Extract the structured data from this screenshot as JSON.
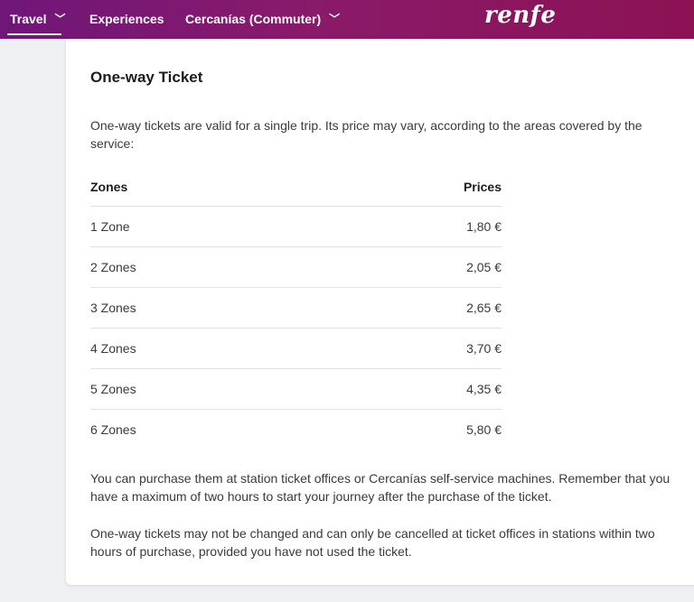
{
  "nav": {
    "travel": "Travel",
    "experiences": "Experiences",
    "cercanias": "Cercanías (Commuter)",
    "logo": "renfe"
  },
  "colors": {
    "brand_gradient_start": "#6f1679",
    "brand_gradient_end": "#8c1254"
  },
  "card": {
    "title": "One-way Ticket",
    "intro": "One-way tickets are valid for a single trip. Its price may vary, according to the areas covered by the service:",
    "table": {
      "headers": [
        "Zones",
        "Prices"
      ],
      "rows": [
        {
          "zone": "1 Zone",
          "price": "1,80 €"
        },
        {
          "zone": "2 Zones",
          "price": "2,05 €"
        },
        {
          "zone": "3 Zones",
          "price": "2,65 €"
        },
        {
          "zone": "4 Zones",
          "price": "3,70 €"
        },
        {
          "zone": "5 Zones",
          "price": "4,35 €"
        },
        {
          "zone": "6 Zones",
          "price": "5,80 €"
        }
      ]
    },
    "purchase_note": "You can purchase them at station ticket offices or Cercanías self-service machines. Remember that you have a maximum of two hours to start your journey after the purchase of the ticket.",
    "change_note": "One-way tickets may not be changed and can only be cancelled at ticket offices in stations within two hours of purchase, provided you have not used the ticket."
  }
}
